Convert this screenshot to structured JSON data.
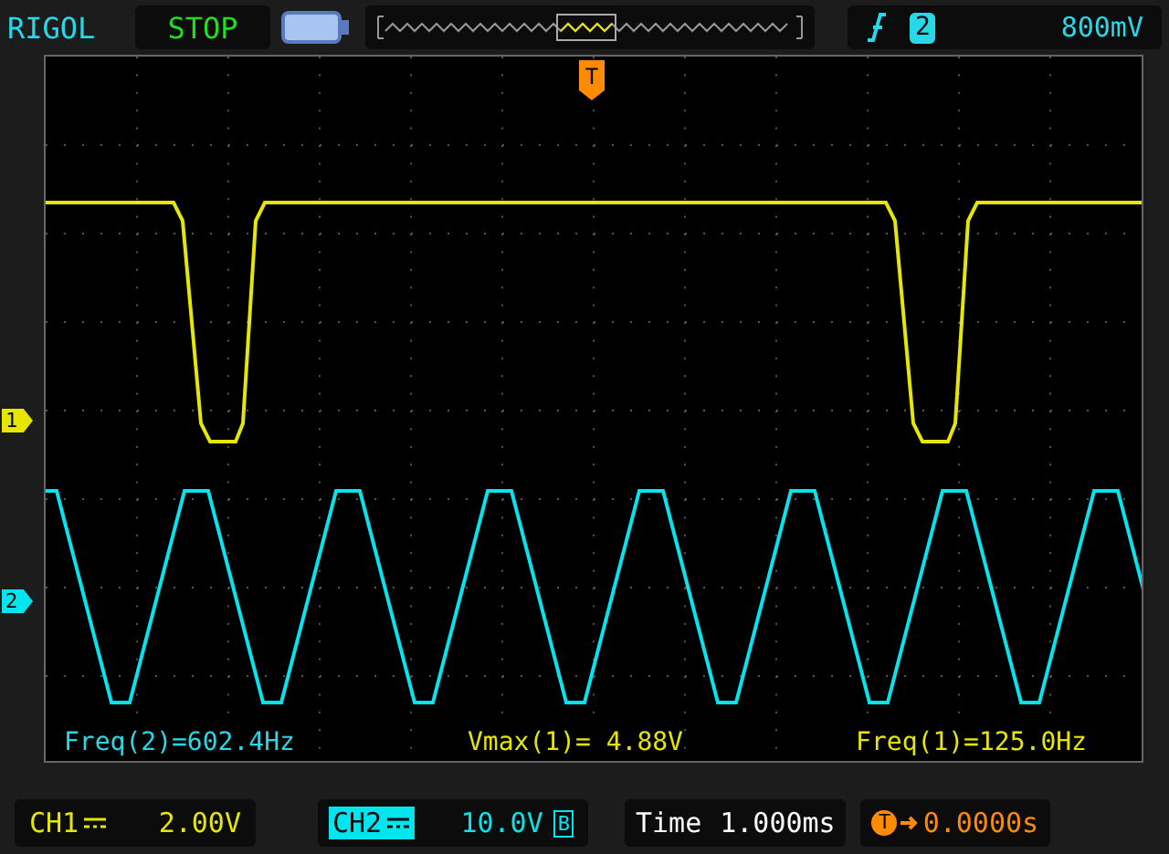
{
  "brand": "RIGOL",
  "run_state": "STOP",
  "trigger": {
    "source": "2",
    "level": "800mV",
    "marker": "T"
  },
  "channel_markers": [
    {
      "label": "1",
      "color": "#e6e600"
    },
    {
      "label": "2",
      "color": "#00e5ee"
    }
  ],
  "measurements": [
    {
      "text": "Freq(2)=602.4Hz",
      "color": "#27d8e8"
    },
    {
      "text": "Vmax(1)= 4.88V",
      "color": "#e6e600"
    },
    {
      "text": "Freq(1)=125.0Hz",
      "color": "#e6e600"
    }
  ],
  "channels": [
    {
      "label": "CH1",
      "scale": "2.00V",
      "selected": false,
      "color": "#e6e600"
    },
    {
      "label": "CH2",
      "scale": "10.0V",
      "selected": true,
      "bandwidth_limit": "B",
      "color": "#00e5ee"
    }
  ],
  "timebase": {
    "label": "Time",
    "value": "1.000ms"
  },
  "trigger_offset": {
    "badge": "T",
    "value": "0.0000s"
  }
}
